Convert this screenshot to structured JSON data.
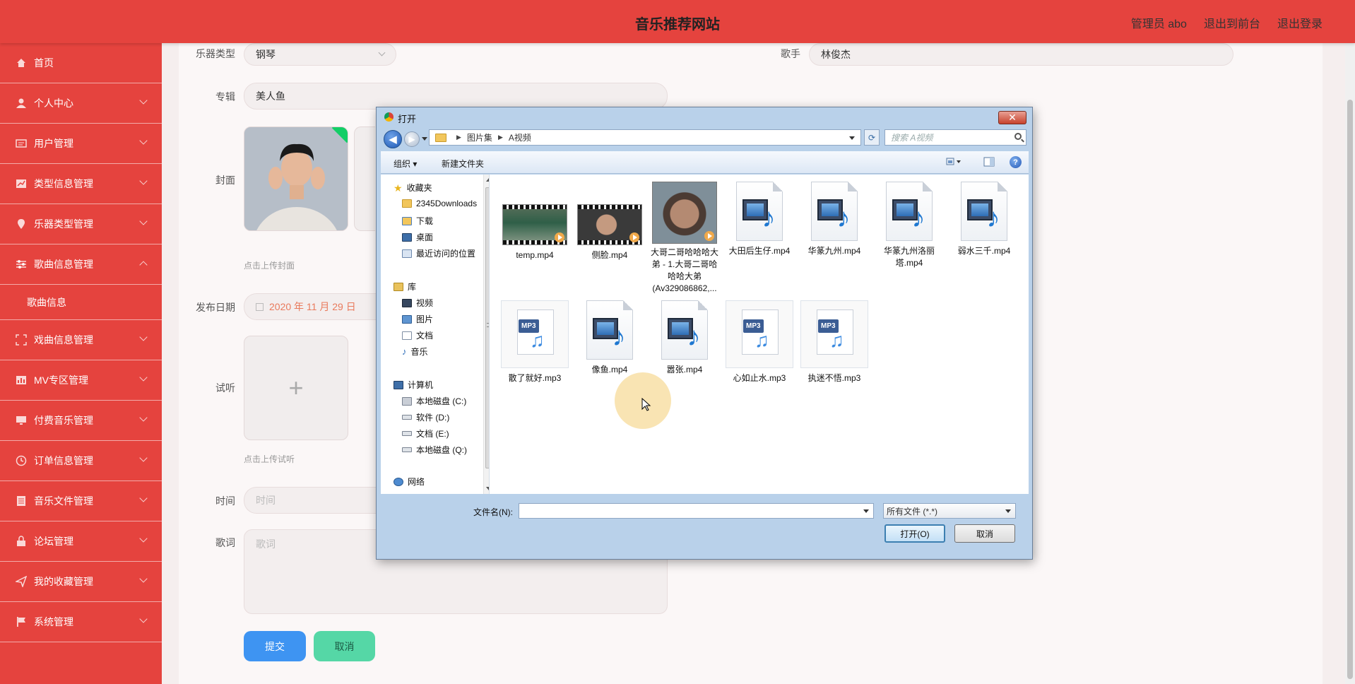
{
  "header": {
    "title": "音乐推荐网站",
    "admin": "管理员 abo",
    "to_front": "退出到前台",
    "logout": "退出登录"
  },
  "sidebar": {
    "items": [
      {
        "label": "首页",
        "icon": "home-icon"
      },
      {
        "label": "个人中心",
        "icon": "user-icon"
      },
      {
        "label": "用户管理",
        "icon": "users-icon"
      },
      {
        "label": "类型信息管理",
        "icon": "chart-icon"
      },
      {
        "label": "乐器类型管理",
        "icon": "pin-icon"
      },
      {
        "label": "歌曲信息管理",
        "icon": "sliders-icon"
      },
      {
        "label": "戏曲信息管理",
        "icon": "frame-icon"
      },
      {
        "label": "MV专区管理",
        "icon": "bars-icon"
      },
      {
        "label": "付费音乐管理",
        "icon": "monitor-icon"
      },
      {
        "label": "订单信息管理",
        "icon": "clock-icon"
      },
      {
        "label": "音乐文件管理",
        "icon": "file-icon"
      },
      {
        "label": "论坛管理",
        "icon": "lock-icon"
      },
      {
        "label": "我的收藏管理",
        "icon": "send-icon"
      },
      {
        "label": "系统管理",
        "icon": "flag-icon"
      }
    ],
    "sub_item": "歌曲信息"
  },
  "form": {
    "instrument_label": "乐器类型",
    "instrument_value": "钢琴",
    "singer_label": "歌手",
    "singer_value": "林俊杰",
    "album_label": "专辑",
    "album_value": "美人鱼",
    "cover_label": "封面",
    "cover_hint": "点击上传封面",
    "date_label": "发布日期",
    "date_value": "2020 年 11 月 29 日",
    "audition_label": "试听",
    "audition_hint": "点击上传试听",
    "time_label": "时间",
    "time_placeholder": "时间",
    "lyrics_label": "歌词",
    "lyrics_placeholder": "歌词",
    "submit": "提交",
    "cancel": "取消"
  },
  "dialog": {
    "title": "打开",
    "path": [
      "图片集",
      "A视频"
    ],
    "search_placeholder": "搜索 A视频",
    "organize": "组织 ▾",
    "new_folder": "新建文件夹",
    "nav": {
      "favorites": "收藏夹",
      "fav_items": [
        "2345Downloads",
        "下载",
        "桌面",
        "最近访问的位置"
      ],
      "libraries": "库",
      "lib_items": [
        "视频",
        "图片",
        "文档",
        "音乐"
      ],
      "computer": "计算机",
      "drives": [
        "本地磁盘 (C:)",
        "软件 (D:)",
        "文档 (E:)",
        "本地磁盘 (Q:)"
      ],
      "network": "网络"
    },
    "files": [
      "temp.mp4",
      "侧脸.mp4",
      "大哥二哥哈哈哈大弟 - 1.大哥二哥哈哈哈大弟(Av329086862,...",
      "大田后生仔.mp4",
      "华篆九州.mp4",
      "华篆九州洛丽塔.mp4",
      "弱水三千.mp4",
      "散了就好.mp3",
      "像鱼.mp4",
      "嚣张.mp4",
      "心如止水.mp3",
      "执迷不悟.mp3"
    ],
    "filename_label": "文件名(N):",
    "filename_value": "",
    "filetype": "所有文件 (*.*)",
    "open_button": "打开(O)",
    "cancel_button": "取消"
  }
}
